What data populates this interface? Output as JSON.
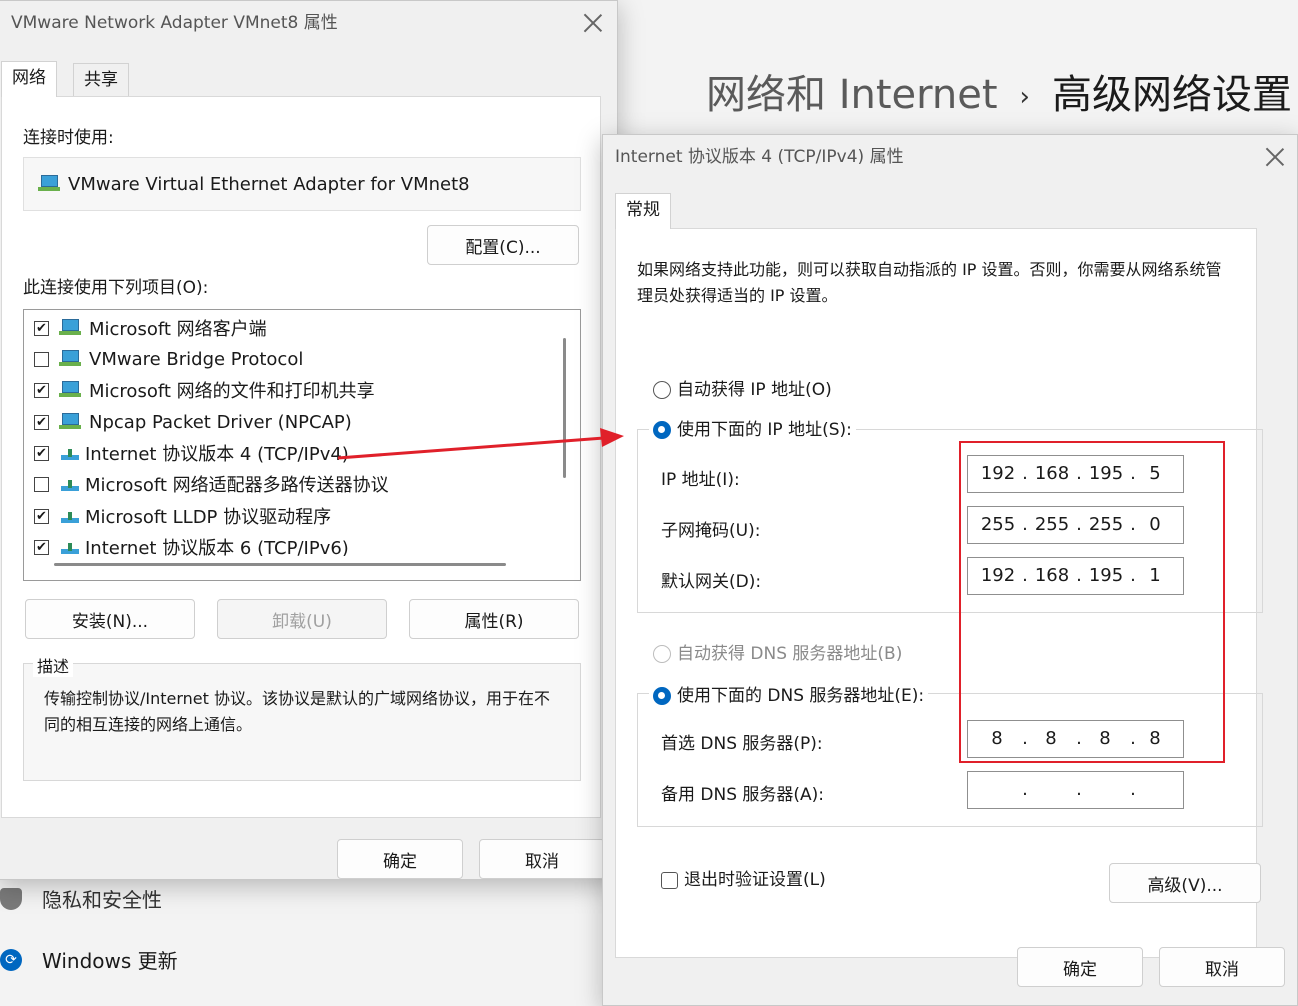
{
  "background": {
    "breadcrumb_parent": "网络和 Internet",
    "breadcrumb_sep": "›",
    "breadcrumb_current": "高级网络设置",
    "nav_privacy": "隐私和安全性",
    "nav_update": "Windows 更新"
  },
  "adapter_dialog": {
    "title": "VMware Network Adapter VMnet8 属性",
    "tabs": [
      "网络",
      "共享"
    ],
    "connect_using_label": "连接时使用:",
    "adapter_name": "VMware Virtual Ethernet Adapter for VMnet8",
    "configure_button": "配置(C)...",
    "items_label": "此连接使用下列项目(O):",
    "items": [
      {
        "label": "Microsoft 网络客户端",
        "checked": true,
        "icon": "network-client-icon"
      },
      {
        "label": "VMware Bridge Protocol",
        "checked": false,
        "icon": "network-client-icon"
      },
      {
        "label": "Microsoft 网络的文件和打印机共享",
        "checked": true,
        "icon": "network-client-icon"
      },
      {
        "label": "Npcap Packet Driver (NPCAP)",
        "checked": true,
        "icon": "network-client-icon"
      },
      {
        "label": "Internet 协议版本 4 (TCP/IPv4)",
        "checked": true,
        "icon": "protocol-icon"
      },
      {
        "label": "Microsoft 网络适配器多路传送器协议",
        "checked": false,
        "icon": "protocol-icon"
      },
      {
        "label": "Microsoft LLDP 协议驱动程序",
        "checked": true,
        "icon": "protocol-icon"
      },
      {
        "label": "Internet 协议版本 6 (TCP/IPv6)",
        "checked": true,
        "icon": "protocol-icon"
      }
    ],
    "install_button": "安装(N)...",
    "uninstall_button": "卸载(U)",
    "properties_button": "属性(R)",
    "description_label": "描述",
    "description_text": "传输控制协议/Internet 协议。该协议是默认的广域网络协议，用于在不同的相互连接的网络上通信。",
    "ok_button": "确定",
    "cancel_button": "取消"
  },
  "ipv4_dialog": {
    "title": "Internet 协议版本 4 (TCP/IPv4) 属性",
    "tab": "常规",
    "intro": "如果网络支持此功能，则可以获取自动指派的 IP 设置。否则，你需要从网络系统管理员处获得适当的 IP 设置。",
    "auto_ip_radio": "自动获得 IP 地址(O)",
    "manual_ip_radio": "使用下面的 IP 地址(S):",
    "ip_label": "IP 地址(I):",
    "ip_value": [
      "192",
      "168",
      "195",
      "5"
    ],
    "subnet_label": "子网掩码(U):",
    "subnet_value": [
      "255",
      "255",
      "255",
      "0"
    ],
    "gateway_label": "默认网关(D):",
    "gateway_value": [
      "192",
      "168",
      "195",
      "1"
    ],
    "auto_dns_radio": "自动获得 DNS 服务器地址(B)",
    "manual_dns_radio": "使用下面的 DNS 服务器地址(E):",
    "preferred_dns_label": "首选 DNS 服务器(P):",
    "preferred_dns_value": [
      "8",
      "8",
      "8",
      "8"
    ],
    "alternate_dns_label": "备用 DNS 服务器(A):",
    "alternate_dns_value": [
      "",
      "",
      "",
      ""
    ],
    "validate_checkbox": "退出时验证设置(L)",
    "advanced_button": "高级(V)...",
    "ok_button": "确定",
    "cancel_button": "取消"
  },
  "colors": {
    "annotation_red": "#e0202a",
    "accent_blue": "#0067c0"
  }
}
